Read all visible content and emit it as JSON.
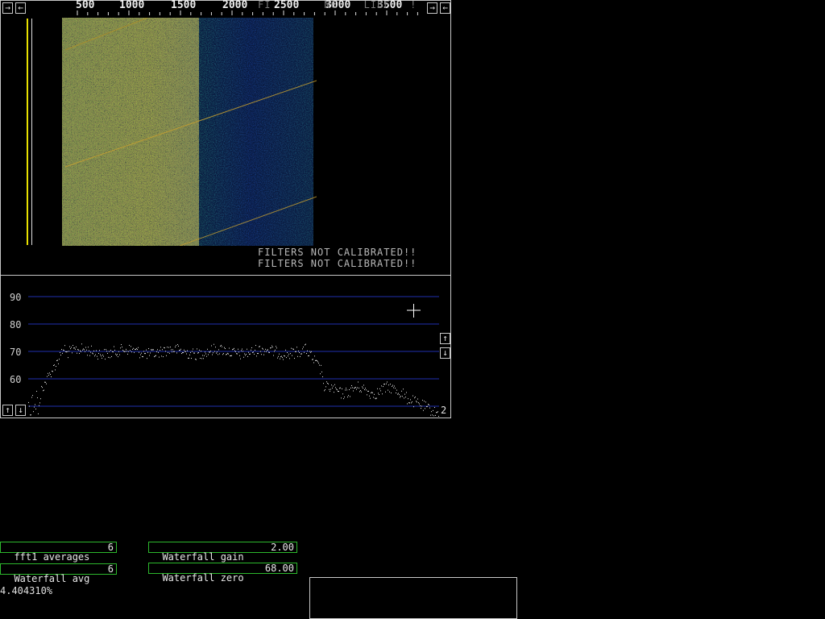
{
  "waterfall": {
    "scale_ticks": [
      "500",
      "1000",
      "1500",
      "2000",
      "2500",
      "3000",
      "3500"
    ],
    "scroll_left_arrows": [
      "→",
      "←"
    ],
    "scroll_right_arrows": [
      "→",
      "←"
    ],
    "warning_text": "FILTERS NOT CALIBRATED!!",
    "overlay_fragment": "FI        NC    LIBF   !"
  },
  "spectrum": {
    "y_labels": [
      "90",
      "80",
      "70",
      "60"
    ],
    "gain_up_arrow": "↑",
    "gain_down_arrow": "↓",
    "left_up_arrow": "↑",
    "left_down_arrow": "↓",
    "channel_number": "2"
  },
  "params": {
    "fft1_averages": {
      "label": "fft1 averages",
      "value": "6"
    },
    "waterfall_avg": {
      "label": "Waterfall avg",
      "value": "6"
    },
    "waterfall_gain": {
      "label": "Waterfall gain",
      "value": "2.00"
    },
    "waterfall_zero": {
      "label": "Waterfall zero",
      "value": "68.00"
    }
  },
  "status": {
    "percent": "4.404310%"
  },
  "colors": {
    "frame": "#c8c8c8",
    "gridline": "#1f2fb0",
    "param_border": "#2db82d",
    "cursor_line_yellow": "#e8e000"
  }
}
